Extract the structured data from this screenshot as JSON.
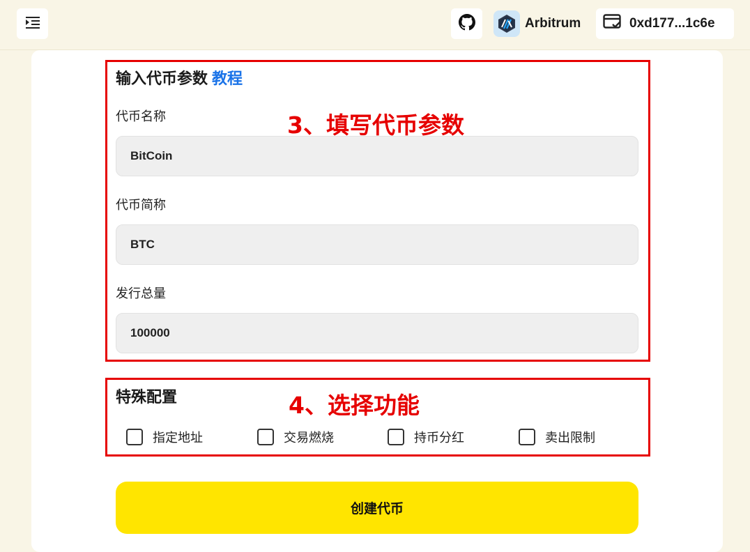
{
  "header": {
    "chain_name": "Arbitrum",
    "wallet_address": "0xd177...1c6e"
  },
  "token_params": {
    "title": "输入代币参数",
    "tutorial_link": "教程",
    "name_label": "代币名称",
    "name_value": "BitCoin",
    "symbol_label": "代币简称",
    "symbol_value": "BTC",
    "supply_label": "发行总量",
    "supply_value": "100000"
  },
  "special_config": {
    "title": "特殊配置",
    "options": [
      "指定地址",
      "交易燃烧",
      "持币分红",
      "卖出限制"
    ]
  },
  "annotations": {
    "step3": "3、填写代币参数",
    "step4": "4、选择功能"
  },
  "create_button_label": "创建代币",
  "colors": {
    "background": "#f9f5e6",
    "accent_yellow": "#ffe500",
    "link_blue": "#1a73e8",
    "annotation_red": "#e60000"
  }
}
